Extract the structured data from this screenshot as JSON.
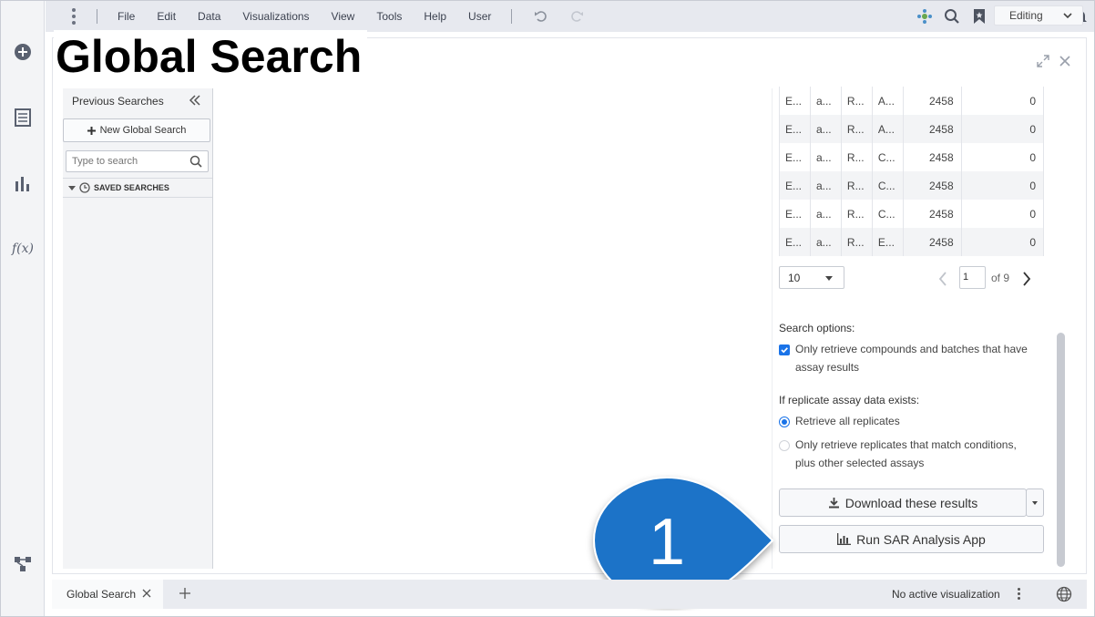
{
  "menubar": {
    "items": [
      "File",
      "Edit",
      "Data",
      "Visualizations",
      "View",
      "Tools",
      "Help",
      "User"
    ],
    "mode": "Editing"
  },
  "page": {
    "title": "Global Search"
  },
  "searches_pane": {
    "header": "Previous Searches",
    "new_search_label": "New Global Search",
    "search_placeholder": "Type to search",
    "saved_label": "SAVED SEARCHES"
  },
  "results": {
    "rows": [
      [
        "E...",
        "a...",
        "R...",
        "A...",
        "2458",
        "0"
      ],
      [
        "E...",
        "a...",
        "R...",
        "A...",
        "2458",
        "0"
      ],
      [
        "E...",
        "a...",
        "R...",
        "C...",
        "2458",
        "0"
      ],
      [
        "E...",
        "a...",
        "R...",
        "C...",
        "2458",
        "0"
      ],
      [
        "E...",
        "a...",
        "R...",
        "C...",
        "2458",
        "0"
      ],
      [
        "E...",
        "a...",
        "R...",
        "E...",
        "2458",
        "0"
      ]
    ],
    "page_size": "10",
    "current_page": "1",
    "of_label": "of",
    "total_pages": "9"
  },
  "options": {
    "search_options_label": "Search options:",
    "only_retrieve_label_1": "Only retrieve compounds and batches that have",
    "only_retrieve_label_2": "assay results",
    "replicate_label": "If replicate assay data exists:",
    "retrieve_all_label": "Retrieve all replicates",
    "match_label_1": "Only retrieve replicates that match conditions,",
    "match_label_2": "plus other selected assays"
  },
  "actions": {
    "download_label": "Download these results",
    "sar_label": "Run SAR Analysis App"
  },
  "callout": {
    "number": "1",
    "color": "#1a73c8"
  },
  "bottom": {
    "tab_label": "Global Search",
    "status": "No active visualization"
  }
}
